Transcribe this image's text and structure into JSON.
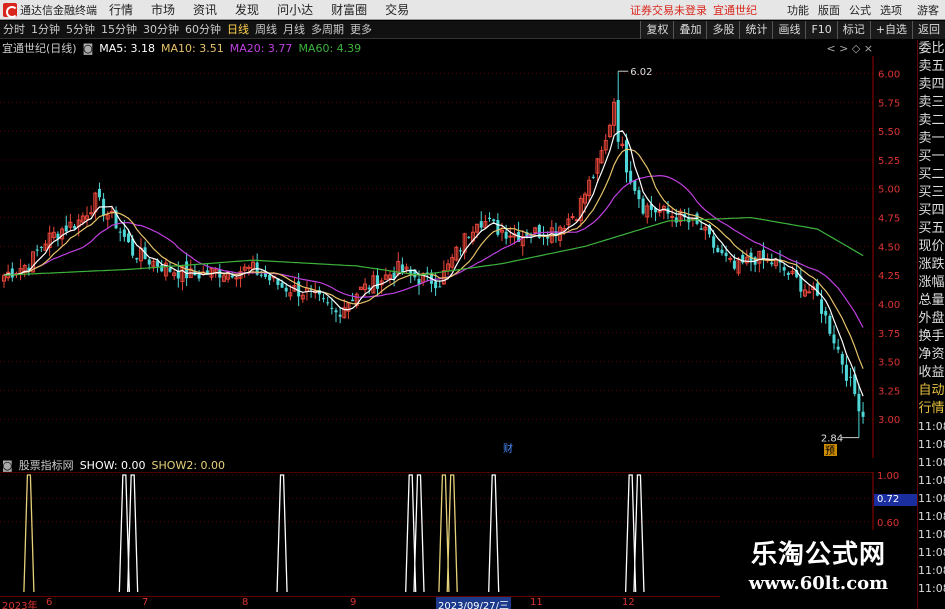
{
  "app": {
    "title": "通达信金融终端"
  },
  "menu": [
    "行情",
    "市场",
    "资讯",
    "发现",
    "问小达",
    "财富圈",
    "交易"
  ],
  "notice": "证券交易未登录",
  "current_stock": "宜通世纪",
  "right_menu": [
    "功能",
    "版面",
    "公式",
    "选项"
  ],
  "guest": "游客",
  "timeframes": [
    "分时",
    "1分钟",
    "5分钟",
    "15分钟",
    "30分钟",
    "60分钟",
    "日线",
    "周线",
    "月线",
    "多周期",
    "更多"
  ],
  "active_timeframe": "日线",
  "right_tools": [
    "复权",
    "叠加",
    "多股",
    "统计",
    "画线",
    "F10",
    "标记",
    "+自选",
    "返回"
  ],
  "info": {
    "stock_label": "宜通世纪(日线)",
    "ma5": "MA5: 3.18",
    "ma10": "MA10: 3.51",
    "ma20": "MA20: 3.77",
    "ma60": "MA60: 4.39"
  },
  "controls": "< >  ◇  ×",
  "colors": {
    "up": "#e8463a",
    "down": "#4fd6d6",
    "ma5": "#ffffff",
    "ma10": "#e6c36a",
    "ma20": "#c040e0",
    "ma60": "#3cb33c",
    "ind1": "#ffffff",
    "ind2": "#e6d27a"
  },
  "price_axis": [
    "6.00",
    "5.75",
    "5.50",
    "5.25",
    "5.00",
    "4.75",
    "4.50",
    "4.25",
    "4.00",
    "3.75",
    "3.50",
    "3.25",
    "3.00"
  ],
  "annotations": {
    "high": "6.02",
    "low": "2.84",
    "cai": "财",
    "ban": "预"
  },
  "indicator": {
    "name": "股票指标网",
    "show": "SHOW: 0.00",
    "show2": "SHOW2: 0.00",
    "axis": [
      "1.00",
      "0.80",
      "0.60"
    ],
    "current": "0.72"
  },
  "right_panel": [
    "委比",
    "卖五",
    "卖四",
    "卖三",
    "卖二",
    "卖一",
    "买一",
    "买二",
    "买三",
    "买四",
    "买五",
    "现价",
    "涨跌",
    "涨幅",
    "总量",
    "外盘",
    "换手",
    "净资",
    "收益",
    "自动",
    "行情"
  ],
  "times": [
    "11:08",
    "11:08",
    "11:08",
    "11:08",
    "11:08",
    "11:08",
    "11:08",
    "11:08",
    "11:08",
    "11:08"
  ],
  "dates": [
    {
      "label": "2023年",
      "x": 2
    },
    {
      "label": "6",
      "x": 46
    },
    {
      "label": "7",
      "x": 142
    },
    {
      "label": "8",
      "x": 242
    },
    {
      "label": "9",
      "x": 350
    },
    {
      "label": "11",
      "x": 530
    },
    {
      "label": "12",
      "x": 622
    }
  ],
  "date_highlight": "2023/09/27/三",
  "watermark": {
    "cn": "乐淘公式网",
    "url": "www.60lt.com"
  },
  "chart_data": {
    "type": "candlestick",
    "y_range": [
      2.75,
      6.1
    ],
    "anchors": [
      [
        0,
        4.25
      ],
      [
        6,
        4.35
      ],
      [
        10,
        4.55
      ],
      [
        14,
        4.65
      ],
      [
        18,
        4.72
      ],
      [
        22,
        4.9
      ],
      [
        27,
        4.7
      ],
      [
        31,
        4.45
      ],
      [
        35,
        4.38
      ],
      [
        40,
        4.3
      ],
      [
        45,
        4.25
      ],
      [
        52,
        4.28
      ],
      [
        60,
        4.3
      ],
      [
        67,
        4.15
      ],
      [
        73,
        4.1
      ],
      [
        80,
        3.92
      ],
      [
        85,
        4.1
      ],
      [
        90,
        4.2
      ],
      [
        95,
        4.3
      ],
      [
        100,
        4.22
      ],
      [
        105,
        4.2
      ],
      [
        110,
        4.5
      ],
      [
        114,
        4.75
      ],
      [
        119,
        4.65
      ],
      [
        124,
        4.6
      ],
      [
        128,
        4.62
      ],
      [
        133,
        4.65
      ],
      [
        138,
        4.8
      ],
      [
        143,
        5.2
      ],
      [
        147,
        5.6
      ],
      [
        150,
        5.2
      ],
      [
        154,
        4.85
      ],
      [
        158,
        4.8
      ],
      [
        163,
        4.75
      ],
      [
        168,
        4.65
      ],
      [
        172,
        4.45
      ],
      [
        176,
        4.3
      ],
      [
        181,
        4.4
      ],
      [
        186,
        4.35
      ],
      [
        191,
        4.2
      ],
      [
        196,
        4.05
      ],
      [
        200,
        3.7
      ],
      [
        204,
        3.3
      ],
      [
        207,
        3.05
      ]
    ],
    "ma60_anchors": [
      [
        0,
        4.25
      ],
      [
        30,
        4.3
      ],
      [
        60,
        4.38
      ],
      [
        85,
        4.33
      ],
      [
        100,
        4.25
      ],
      [
        120,
        4.35
      ],
      [
        140,
        4.5
      ],
      [
        160,
        4.72
      ],
      [
        180,
        4.75
      ],
      [
        196,
        4.65
      ],
      [
        207,
        4.42
      ]
    ],
    "high_low": {
      "high": 6.02,
      "low": 2.84
    },
    "indicator_spikes": [
      {
        "x": 6,
        "c": "ind2"
      },
      {
        "x": 29,
        "c": "ind1"
      },
      {
        "x": 31,
        "c": "ind1"
      },
      {
        "x": 67,
        "c": "ind1"
      },
      {
        "x": 98,
        "c": "ind1"
      },
      {
        "x": 100,
        "c": "ind1"
      },
      {
        "x": 106,
        "c": "ind2"
      },
      {
        "x": 108,
        "c": "ind2"
      },
      {
        "x": 118,
        "c": "ind1"
      },
      {
        "x": 151,
        "c": "ind1"
      },
      {
        "x": 153,
        "c": "ind1"
      }
    ]
  }
}
